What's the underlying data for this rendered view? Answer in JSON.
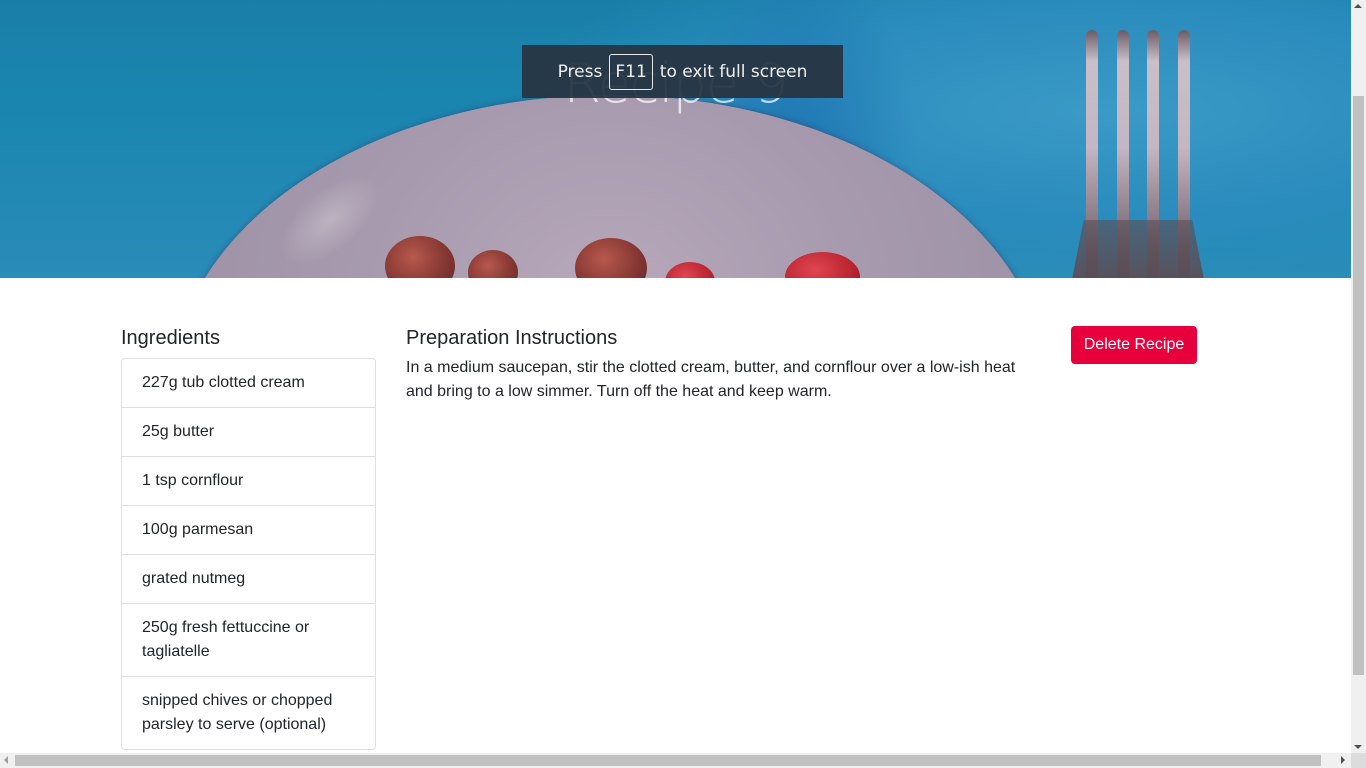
{
  "hero": {
    "title": "Recipe 9"
  },
  "fullscreen_notice": {
    "prefix": "Press",
    "key": "F11",
    "suffix": "to exit full screen"
  },
  "ingredients": {
    "title": "Ingredients",
    "items": [
      "227g tub clotted cream",
      "25g butter",
      "1 tsp cornflour",
      "100g parmesan",
      "grated nutmeg",
      "250g fresh fettuccine or tagliatelle",
      "snipped chives or chopped parsley to serve (optional)"
    ]
  },
  "instructions": {
    "title": "Preparation Instructions",
    "text": "In a medium saucepan, stir the clotted cream, butter, and cornflour over a low-ish heat and bring to a low simmer. Turn off the heat and keep warm."
  },
  "actions": {
    "delete_label": "Delete Recipe"
  },
  "colors": {
    "danger": "#e8003d",
    "hero_blue": "#1a7fa8"
  }
}
